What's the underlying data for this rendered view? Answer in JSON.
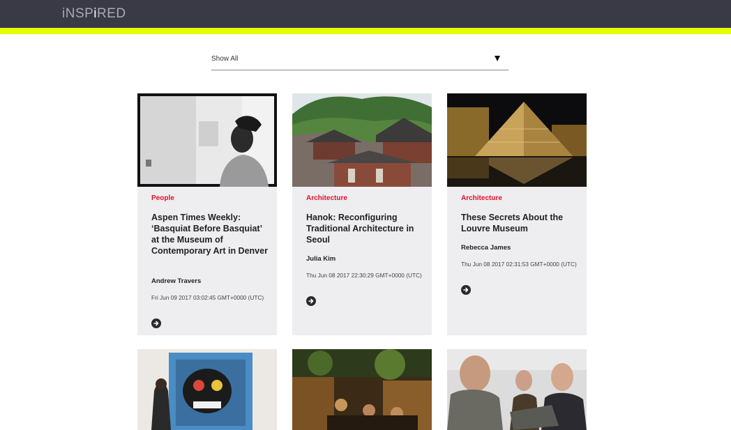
{
  "header": {
    "logo_pre": "iNSP",
    "logo_hi": "i",
    "logo_post": "RED"
  },
  "filter": {
    "selected": "Show All"
  },
  "colors": {
    "topbar": "#3a3a46",
    "accent": "#e6ff00",
    "category": "#e0102b",
    "card_bg": "#eeeef1"
  },
  "cards": [
    {
      "category": "People",
      "title": "Aspen Times Weekly: ‘Basquiat Before Basquiat’ at the Museum of Contemporary Art in Denver",
      "author": "Andrew Travers",
      "date": "Fri Jun 09 2017 03:02:45 GMT+0000 (UTC)",
      "image_icon": "photo-portrait-bw"
    },
    {
      "category": "Architecture",
      "title": "Hanok: Reconfiguring Traditional Architecture in Seoul",
      "author": "Julia Kim",
      "date": "Thu Jun 08 2017 22:30:29 GMT+0000 (UTC)",
      "image_icon": "photo-hanok-roofs"
    },
    {
      "category": "Architecture",
      "title": "These Secrets About the Louvre Museum",
      "author": "Rebecca James",
      "date": "Thu Jun 08 2017 02:31:53 GMT+0000 (UTC)",
      "image_icon": "photo-louvre-pyramid"
    }
  ],
  "second_row_images": [
    "photo-basquiat-painting",
    "photo-restaurant-interior",
    "photo-workshop-people"
  ]
}
